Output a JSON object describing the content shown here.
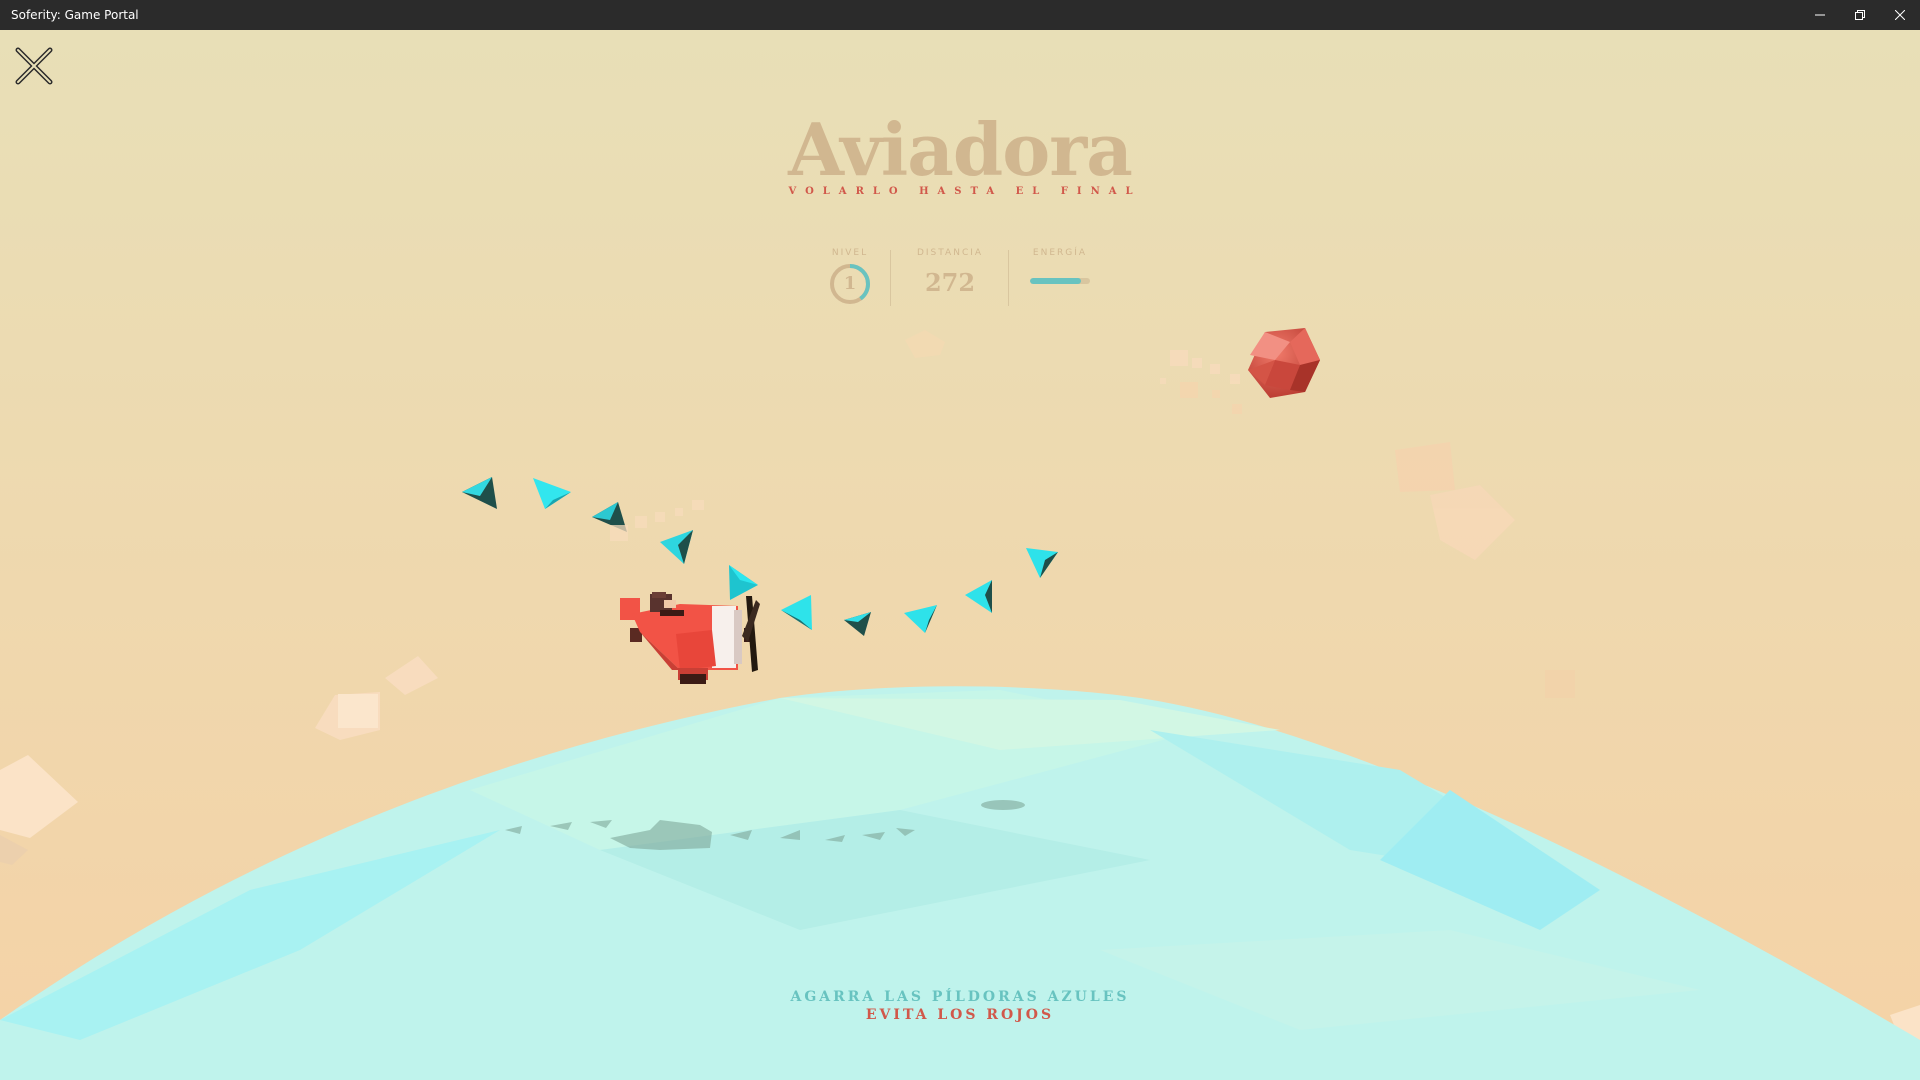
{
  "window": {
    "title": "Soferity: Game Portal"
  },
  "game": {
    "title": "Aviadora",
    "subtitle": "VOLARLO HASTA EL FINAL",
    "stats": {
      "level_label": "NIVEL",
      "level_value": "1",
      "level_progress": 0.4,
      "distance_label": "DISTANCIA",
      "distance_value": "272",
      "energy_label": "ENERGÍA",
      "energy_level": 0.85
    },
    "instructions": {
      "line1": "AGARRA LAS PÍLDORAS AZULES",
      "line2": "EVITA LOS ROJOS"
    }
  },
  "colors": {
    "sky_top": "#e8dfb7",
    "sky_bottom": "#f5d2a6",
    "sea": "#b9f2ec",
    "title": "#d1b790",
    "accent_red": "#d1584a",
    "accent_blue": "#68c3c0",
    "titlebar": "#2b2b2b"
  },
  "icons": {
    "close_game": "close-x-icon",
    "minimize": "minimize-icon",
    "restore": "restore-icon",
    "close_window": "close-icon"
  }
}
